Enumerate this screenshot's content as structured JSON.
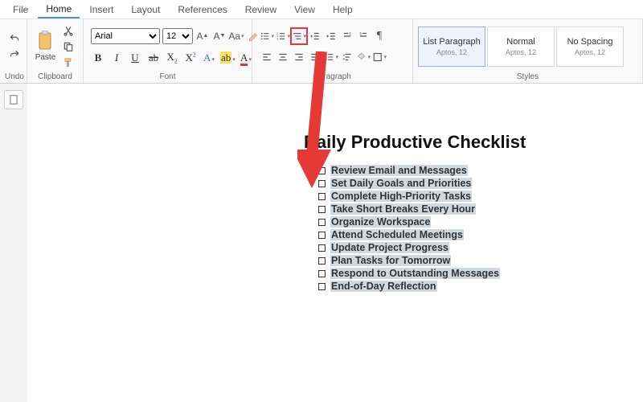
{
  "menu": {
    "file": "File",
    "home": "Home",
    "insert": "Insert",
    "layout": "Layout",
    "references": "References",
    "review": "Review",
    "view": "View",
    "help": "Help",
    "active": "home"
  },
  "ribbon": {
    "undo_group": "Undo",
    "clipboard_group": "Clipboard",
    "font_group": "Font",
    "paragraph_group": "Paragraph",
    "styles_group": "Styles",
    "paste": "Paste",
    "font_name": "Arial",
    "font_size": "12"
  },
  "styles": {
    "list_paragraph": {
      "name": "List Paragraph",
      "sub": "Aptos, 12"
    },
    "normal": {
      "name": "Normal",
      "sub": "Aptos, 12"
    },
    "no_spacing": {
      "name": "No Spacing",
      "sub": "Aptos, 12"
    }
  },
  "document": {
    "title": "Daily Productive Checklist",
    "items": [
      "Review Email and Messages",
      "Set Daily Goals and Priorities",
      " Complete High-Priority Tasks",
      "Take Short Breaks Every Hour",
      "Organize Workspace",
      " Attend Scheduled Meetings",
      "Update Project Progress",
      " Plan Tasks for Tomorrow",
      "Respond to Outstanding Messages",
      "End-of-Day Reflection"
    ]
  }
}
